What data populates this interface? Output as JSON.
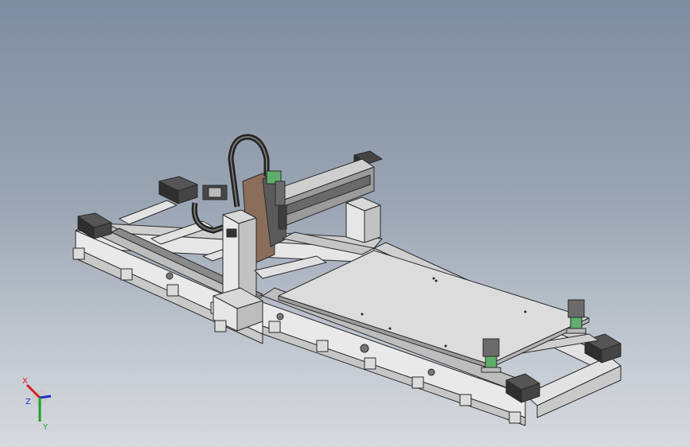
{
  "viewport": {
    "background_top": "#7f8da0",
    "background_bottom": "#d6dadf"
  },
  "triad": {
    "x_label": "X",
    "y_label": "Y",
    "z_label": "Z",
    "x_color": "#d22020",
    "y_color": "#20a020",
    "z_color": "#2030c8"
  },
  "model": {
    "part_fill": "#d9d9d9",
    "part_edge": "#2a2a2a",
    "dark_part": "#3c3c3c",
    "accent_green": "#5fae6b"
  }
}
